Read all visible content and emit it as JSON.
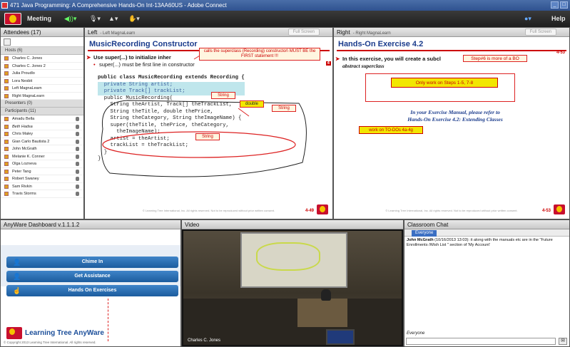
{
  "window": {
    "title": "471 Java Programming: A Comprehensive Hands-On Int-13AA60US - Adobe Connect",
    "minimize": "_",
    "maximize": "□"
  },
  "menubar": {
    "meeting": "Meeting",
    "help": "Help"
  },
  "attendees": {
    "title": "Attendees",
    "count": "(17)",
    "hosts_label": "Hosts (6)",
    "hosts": [
      "Charles C. Jones",
      "Charles C. Jones 2",
      "Julia Proudlo",
      "Lora Nesbit",
      "Left MagnaLearn",
      "Right MagnaLearn"
    ],
    "presenters_label": "Presenters (0)",
    "participants_label": "Participants (11)",
    "participants": [
      "Amadu Bella",
      "Beth Hadsa",
      "Chris Maley",
      "Gian Carlo Bautista 2",
      "John McGrath",
      "Melanie K. Conner",
      "Olga Lozneva",
      "Peter Tang",
      "Robert Swaney",
      "Sam Rivkin",
      "Travis Storms"
    ]
  },
  "left_slide": {
    "panel_title": "Left",
    "panel_sub": "- Left MagnaLearn",
    "fullscreen": "Full Screen",
    "title": "MusicRecording Constructor",
    "bullet1": "Use super(...) to initialize inher",
    "bullet2": "super(...) must be first line in constructor",
    "callout_top": "calls the superclass (Recording) constructor\\\nMUST BE the FIRST statement !!!",
    "code": [
      "public class MusicRecording extends Recording {",
      "  private String artist;",
      "  private Track[] trackList;",
      "",
      "  public MusicRecording(",
      "    String theArtist, Track[] theTrackList,",
      "    String theTitle, double thePrice,",
      "    String theCategory, String theImageName) {",
      "",
      "    super(theTitle, thePrice, theCategory,",
      "      theImageName);",
      "",
      "    artist = theArtist;",
      "    trackList = theTrackList;",
      "  }",
      "}"
    ],
    "label_string1": "String",
    "label_double": "double",
    "label_string2": "String",
    "label_string3": "String",
    "footer": "© Learning Tree International, Inc. All rights reserved. Not to be reproduced without prior written consent.",
    "page": "4-49",
    "corner_num": "4"
  },
  "right_slide": {
    "panel_title": "Right",
    "panel_sub": "- Right MagnaLearn",
    "fullscreen": "Full Screen",
    "title": "Hands-On Exercise 4.2",
    "page_top": "4-53",
    "bullet1": "In this exercise, you will create a subcl",
    "bullet1b": "efined",
    "bullet1c": "abstract superclass",
    "callout_step": "Step#6 is more of a BO",
    "yellow_text": "Only work on Steps 1-5, 7-8",
    "manual_line1": "In your Exercise Manual, please refer to",
    "manual_line2": "Hands-On Exercise 4.2: Extending Classes",
    "todo": "work on TO-DOs 4a-4g",
    "footer": "© Learning Tree International, Inc. All rights reserved. Not to be reproduced without prior written consent.",
    "page": "4-53"
  },
  "dashboard": {
    "title": "AnyWare Dashboard v.1.1.1.2",
    "chime": "Chime In",
    "assist": "Get Assistance",
    "exercises": "Hands On Exercises",
    "brand": "Learning Tree AnyWare",
    "copyright": "© Copyright 2013 Learning Tree International. All rights reserved."
  },
  "video": {
    "title": "Video",
    "caption": "Charles C. Jones"
  },
  "chat": {
    "title": "Classroom Chat",
    "tab": "Everyone",
    "sender": "John McGrath",
    "message": " (10/16/2013 13:03): it along with the manuals etc are in the \"Future Enrollments /Wish List \" section of 'My Account'",
    "to_label": "Everyone"
  }
}
